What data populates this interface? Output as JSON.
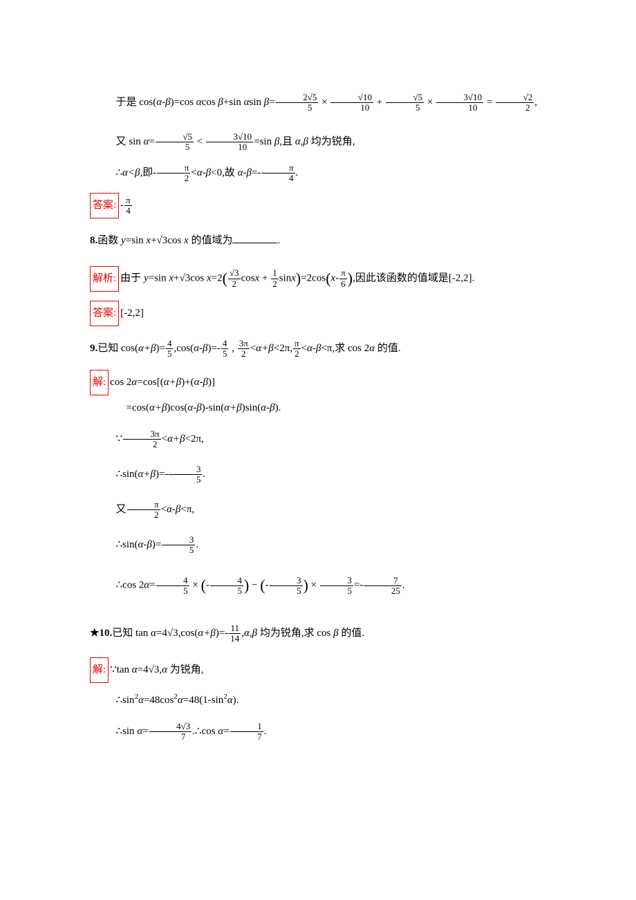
{
  "labels": {
    "answer": "答案:",
    "analysis": "解析:",
    "solution": "解:"
  },
  "p7": {
    "line1_pre": "于是 cos(",
    "ab": "α-β",
    "line1_mid": ")=cos ",
    "a": "α",
    "line1_mid2": "cos ",
    "b": "β",
    "line1_mid3": "+sin ",
    "line1_mid4": "sin ",
    "line1_eq": "=",
    "f1n": "2√5",
    "f1d": "5",
    "times": " × ",
    "f2n": "√10",
    "f2d": "10",
    "plus": " + ",
    "f3n": "√5",
    "f3d": "5",
    "f4n": "3√10",
    "f4d": "10",
    "eq": " = ",
    "f5n": "√2",
    "f5d": "2",
    "comma": ",",
    "line2_pre": "又 sin ",
    "line2_eq": "=",
    "lt": " < ",
    "line2_mid": "=sin ",
    "line2_post": ",且 ",
    "line2_post2": " 均为锐角,",
    "ab_comma": "α,β",
    "line3_pre": "∴",
    "line3_rel": "α<β",
    "line3_mid": ",即-",
    "pi2n": "π",
    "pi2d": "2",
    "line3_mid2": "<",
    "line3_mid3": "<0,故 ",
    "line3_mid4": "=-",
    "pi4n": "π",
    "pi4d": "4",
    "period": ".",
    "ans_pre": "-"
  },
  "p8": {
    "num": "8.",
    "q_pre": "函数 ",
    "y": "y",
    "q_mid": "=sin ",
    "x": "x",
    "q_mid2": "+",
    "sqrt3": "√3",
    "q_mid3": "cos ",
    "q_post": " 的值域为",
    "q_end": ".",
    "ana_pre": "由于 ",
    "ana_mid": "=2",
    "f1n": "√3",
    "f1d": "2",
    "ana_cos": "cos",
    "plus": " + ",
    "f2n": "1",
    "f2d": "2",
    "ana_sin": "sin",
    "ana_mid2": "=2cos",
    "minus": "-",
    "pi6n": "π",
    "pi6d": "6",
    "ana_post": ",因此该函数的值域是[-2,2].",
    "answer": "[-2,2]"
  },
  "p9": {
    "num": "9.",
    "q_pre": "已知 cos(",
    "apb": "α+β",
    "q_mid": ")=",
    "f45n": "4",
    "f45d": "5",
    "q_mid2": ",cos(",
    "amb": "α-β",
    "q_mid3": ")=-",
    "comma_sp": " , ",
    "f3pi2n": "3π",
    "f3pi2d": "2",
    "lt": "<",
    "q_mid4": "<2π,",
    "pi2n": "π",
    "pi2d": "2",
    "q_mid5": "<π,求 cos 2",
    "a": "α",
    "q_post": " 的值.",
    "s1": "cos 2",
    "s1b": "=cos[(",
    "s1c": ")+(",
    "s1d": ")]",
    "s2a": "=cos(",
    "s2b": ")cos(",
    "s2c": ")-sin(",
    "s2d": ")sin(",
    "s2e": ").",
    "s3a": "∵",
    "s3b": "<2π,",
    "s4a": "∴sin(",
    "s4b": ")=-",
    "f35n": "3",
    "f35d": "5",
    "s4c": ".",
    "s5a": "又",
    "s5b": "<π,",
    "s6a": "∴sin(",
    "s6b": ")=",
    "s7a": "∴cos 2",
    "s7b": "=",
    "times": " × ",
    "lp": "(",
    "rp": ")",
    "minus_sp": " − ",
    "neg": "-",
    "s7c": "=-",
    "f725n": "7",
    "f725d": "25"
  },
  "p10": {
    "star": "★",
    "num": "10.",
    "q_pre": "已知 tan ",
    "a": "α",
    "q_mid": "=4",
    "sqrt3": "√3",
    "q_mid2": ",cos(",
    "apb": "α+β",
    "q_mid3": ")=-",
    "f1114n": "11",
    "f1114d": "14",
    "q_mid4": ",",
    "ab": "α,β",
    "q_mid5": " 均为锐角,求 cos ",
    "b": "β",
    "q_post": " 的值.",
    "s1a": "∵tan ",
    "s1b": "=4",
    "s1c": ",",
    "s1d": " 为锐角,",
    "s2a": "∴sin",
    "sq": "2",
    "s2b": "=48cos",
    "s2c": "=48(1-sin",
    "s2d": ").",
    "s3a": "∴sin ",
    "s3b": "=",
    "f4s3_7n": "4√3",
    "f4s3_7d": "7",
    "s3c": ".∴cos ",
    "s3d": "=",
    "f17n": "1",
    "f17d": "7",
    "s3e": "."
  }
}
